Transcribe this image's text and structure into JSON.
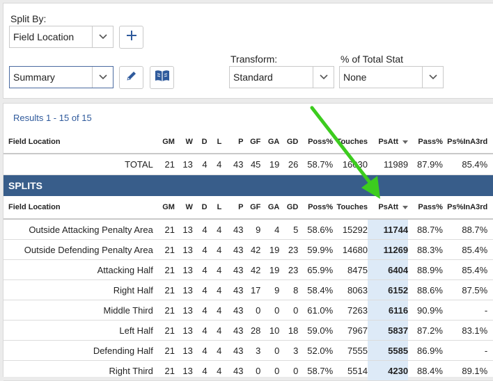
{
  "split_by": {
    "label": "Split By:",
    "selected": "Field Location"
  },
  "report": {
    "selected": "Summary"
  },
  "transform": {
    "label": "Transform:",
    "selected": "Standard"
  },
  "pct_total": {
    "label": "% of Total Stat",
    "selected": "None"
  },
  "results_text": "Results 1 - 15 of 15",
  "columns": [
    "Field Location",
    "GM",
    "W",
    "D",
    "L",
    "P",
    "GF",
    "GA",
    "GD",
    "Poss%",
    "Touches",
    "PsAtt",
    "Pass%",
    "Ps%InA3rd"
  ],
  "total_row": [
    "TOTAL",
    "21",
    "13",
    "4",
    "4",
    "43",
    "45",
    "19",
    "26",
    "58.7%",
    "16030",
    "11989",
    "87.9%",
    "85.4%"
  ],
  "splits_label": "SPLITS",
  "rows": [
    [
      "Outside Attacking Penalty Area",
      "21",
      "13",
      "4",
      "4",
      "43",
      "9",
      "4",
      "5",
      "58.6%",
      "15292",
      "11744",
      "88.7%",
      "88.7%"
    ],
    [
      "Outside Defending Penalty Area",
      "21",
      "13",
      "4",
      "4",
      "43",
      "42",
      "19",
      "23",
      "59.9%",
      "14680",
      "11269",
      "88.3%",
      "85.4%"
    ],
    [
      "Attacking Half",
      "21",
      "13",
      "4",
      "4",
      "43",
      "42",
      "19",
      "23",
      "65.9%",
      "8475",
      "6404",
      "88.9%",
      "85.4%"
    ],
    [
      "Right Half",
      "21",
      "13",
      "4",
      "4",
      "43",
      "17",
      "9",
      "8",
      "58.4%",
      "8063",
      "6152",
      "88.6%",
      "87.5%"
    ],
    [
      "Middle Third",
      "21",
      "13",
      "4",
      "4",
      "43",
      "0",
      "0",
      "0",
      "61.0%",
      "7263",
      "6116",
      "90.9%",
      "-"
    ],
    [
      "Left Half",
      "21",
      "13",
      "4",
      "4",
      "43",
      "28",
      "10",
      "18",
      "59.0%",
      "7967",
      "5837",
      "87.2%",
      "83.1%"
    ],
    [
      "Defending Half",
      "21",
      "13",
      "4",
      "4",
      "43",
      "3",
      "0",
      "3",
      "52.0%",
      "7555",
      "5585",
      "86.9%",
      "-"
    ],
    [
      "Right Third",
      "21",
      "13",
      "4",
      "4",
      "43",
      "0",
      "0",
      "0",
      "58.7%",
      "5514",
      "4230",
      "88.4%",
      "89.1%"
    ]
  ],
  "colors": {
    "link": "#2f5a9c",
    "band": "#385d8a",
    "highlight": "#ddeaf7",
    "annotation_arrow": "#3ccc1e"
  }
}
